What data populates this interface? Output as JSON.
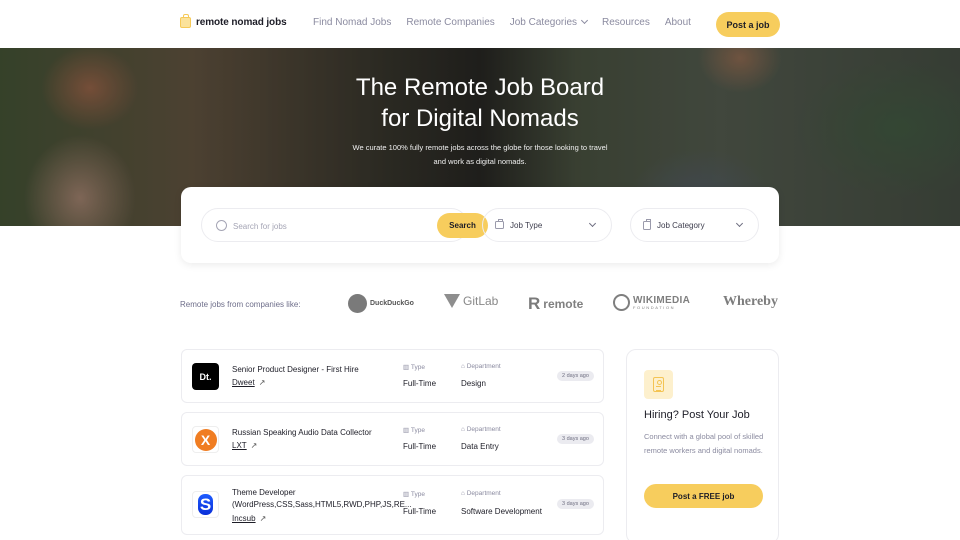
{
  "nav": {
    "logo_text": "remote nomad jobs",
    "links": [
      "Find Nomad Jobs",
      "Remote Companies",
      "Job Categories",
      "Resources",
      "About"
    ],
    "post_button": "Post a job"
  },
  "hero": {
    "title_line1": "The Remote Job Board",
    "title_line2": "for Digital Nomads",
    "subtitle": "We curate 100% fully remote jobs across the globe for those looking to travel and work as digital nomads."
  },
  "search": {
    "placeholder": "Search for jobs",
    "value": "",
    "button": "Search",
    "job_type": "Job Type",
    "job_category": "Job Category"
  },
  "companies": {
    "label": "Remote jobs from companies like:",
    "logos": [
      "DuckDuckGo",
      "GitLab",
      "remote",
      "WIKIMEDIA",
      "FOUNDATION",
      "Whereby"
    ]
  },
  "jobs": [
    {
      "logo_text": "Dt.",
      "title": "Senior Product Designer - First Hire",
      "company": "Dweet",
      "type_label": "Type",
      "type": "Full-Time",
      "dept_label": "Department",
      "department": "Design",
      "age": "2 days ago"
    },
    {
      "logo_text": "X",
      "title": "Russian Speaking Audio Data Collector",
      "company": "LXT",
      "type_label": "Type",
      "type": "Full-Time",
      "dept_label": "Department",
      "department": "Data Entry",
      "age": "3 days ago"
    },
    {
      "logo_text": "S",
      "title": "Theme Developer (WordPress,CSS,Sass,HTML5,RWD,PHP,JS,RE...",
      "company": "Incsub",
      "type_label": "Type",
      "type": "Full-Time",
      "dept_label": "Department",
      "department": "Software Development",
      "age": "3 days ago"
    }
  ],
  "hiring": {
    "title": "Hiring? Post Your Job",
    "text": "Connect with a global pool of skilled remote workers and digital nomads.",
    "button": "Post a FREE job"
  },
  "colors": {
    "accent": "#f7cd5d",
    "text": "#1d1d27",
    "muted": "#8b8ba0"
  }
}
